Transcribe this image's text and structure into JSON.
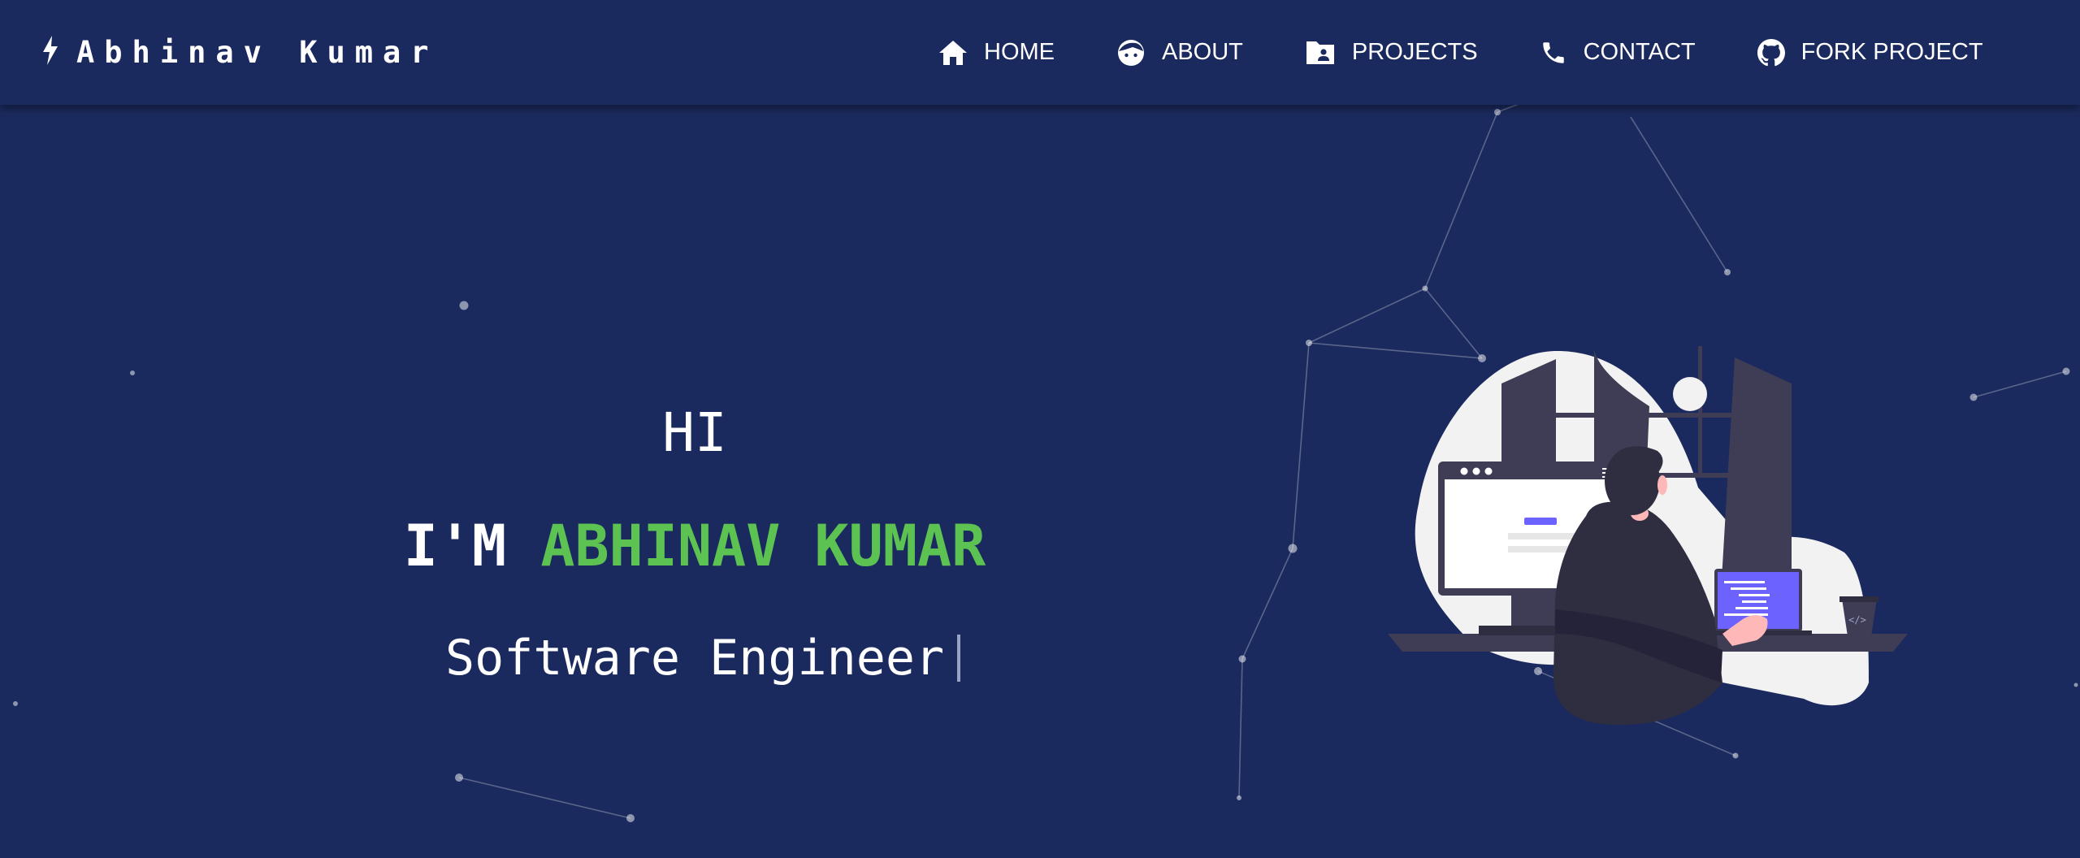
{
  "brand": {
    "name": "Abhinav Kumar",
    "icon": "bolt-icon"
  },
  "nav": {
    "items": [
      {
        "label": "HOME",
        "icon": "home-icon"
      },
      {
        "label": "ABOUT",
        "icon": "face-icon"
      },
      {
        "label": "PROJECTS",
        "icon": "folder-user-icon"
      },
      {
        "label": "CONTACT",
        "icon": "phone-icon"
      },
      {
        "label": "FORK PROJECT",
        "icon": "github-icon"
      }
    ]
  },
  "hero": {
    "greeting": "HI",
    "intro_prefix": "I'M ",
    "name": "ABHINAV KUMAR",
    "role": "Software Engineer"
  },
  "colors": {
    "background": "#1b2a5e",
    "accent": "#5cc251",
    "text": "#ffffff",
    "illustration_purple": "#6c63ff"
  }
}
